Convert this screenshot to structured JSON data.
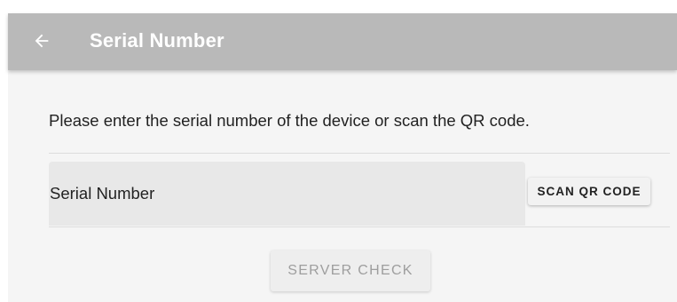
{
  "app_bar": {
    "title": "Serial Number",
    "back_icon": "arrow-left-icon"
  },
  "content": {
    "instructions": "Please enter the serial number of the device or scan the QR code.",
    "serial_field": {
      "placeholder": "Serial Number",
      "value": ""
    },
    "scan_button_label": "SCAN QR CODE",
    "server_check_label": "SERVER CHECK",
    "server_check_enabled": false
  },
  "colors": {
    "app_bar_bg": "#b9b9b9",
    "app_bar_text": "#ffffff",
    "page_bg": "#f5f5f5",
    "field_bg": "#e8e8e8",
    "disabled_text": "#9e9e9e"
  }
}
